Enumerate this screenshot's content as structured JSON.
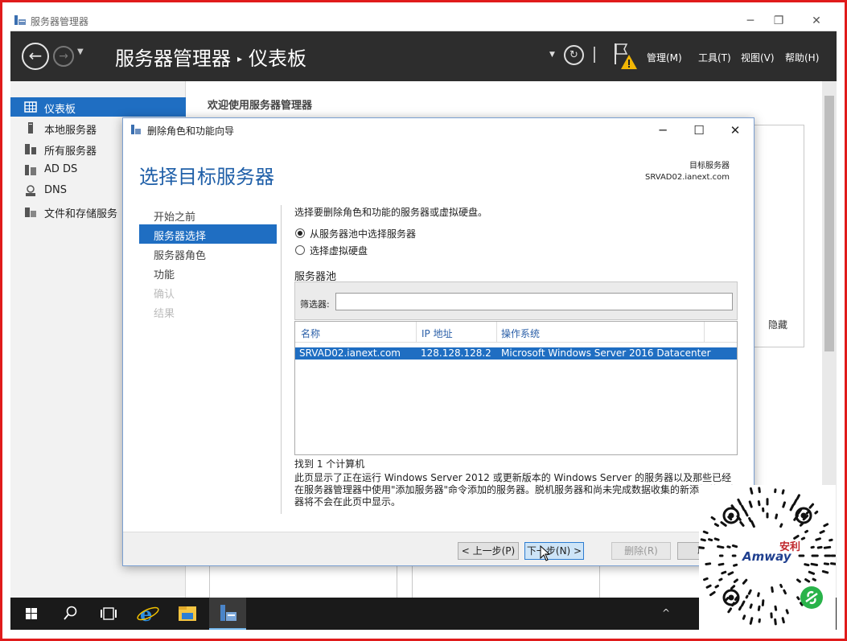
{
  "window": {
    "title": "服务器管理器",
    "controls": {
      "minimize": "─",
      "restore": "❐",
      "close": "✕"
    }
  },
  "header": {
    "app_name": "服务器管理器",
    "breadcrumb_sep": "▸",
    "page": "仪表板",
    "menus": [
      "管理(M)",
      "工具(T)",
      "视图(V)",
      "帮助(H)"
    ]
  },
  "nav": {
    "items": [
      {
        "label": "仪表板",
        "icon": "dashboard-icon",
        "active": true
      },
      {
        "label": "本地服务器",
        "icon": "server-icon",
        "active": false
      },
      {
        "label": "所有服务器",
        "icon": "servers-icon",
        "active": false
      },
      {
        "label": "AD DS",
        "icon": "ad-ds-icon",
        "active": false
      },
      {
        "label": "DNS",
        "icon": "dns-icon",
        "active": false
      },
      {
        "label": "文件和存储服务",
        "icon": "file-storage-icon",
        "active": false
      }
    ]
  },
  "main": {
    "welcome": "欢迎使用服务器管理器",
    "hide_label": "隐藏"
  },
  "wizard": {
    "title": "删除角色和功能向导",
    "page_title": "选择目标服务器",
    "target_label": "目标服务器",
    "target_server": "SRVAD02.ianext.com",
    "steps": [
      {
        "label": "开始之前",
        "state": "normal"
      },
      {
        "label": "服务器选择",
        "state": "active"
      },
      {
        "label": "服务器角色",
        "state": "normal"
      },
      {
        "label": "功能",
        "state": "normal"
      },
      {
        "label": "确认",
        "state": "disabled"
      },
      {
        "label": "结果",
        "state": "disabled"
      }
    ],
    "prompt": "选择要删除角色和功能的服务器或虚拟硬盘。",
    "radio_pool": "从服务器池中选择服务器",
    "radio_vhd": "选择虚拟硬盘",
    "pool_label": "服务器池",
    "filter_label": "筛选器:",
    "filter_value": "",
    "columns": [
      "名称",
      "IP 地址",
      "操作系统"
    ],
    "rows": [
      {
        "name": "SRVAD02.ianext.com",
        "ip": "128.128.128.2",
        "os": "Microsoft Windows Server 2016 Datacenter"
      }
    ],
    "found": "找到 1 个计算机",
    "description": "此页显示了正在运行 Windows Server 2012 或更新版本的 Windows Server 的服务器以及那些已经在服务器管理器中使用\"添加服务器\"命令添加的服务器。脱机服务器和尚未完成数据收集的新添加的服务器将不会在此页中显示。",
    "buttons": {
      "prev": "< 上一步(P)",
      "next": "下一步(N) >",
      "remove": "删除(R)",
      "cancel": "取消"
    }
  },
  "taskbar": {
    "tray": "^",
    "items": [
      "start-icon",
      "search-icon",
      "task-view-icon",
      "ie-icon",
      "file-explorer-icon",
      "server-manager-icon"
    ]
  },
  "watermark": {
    "brand": "Amway",
    "seal": "安利"
  }
}
